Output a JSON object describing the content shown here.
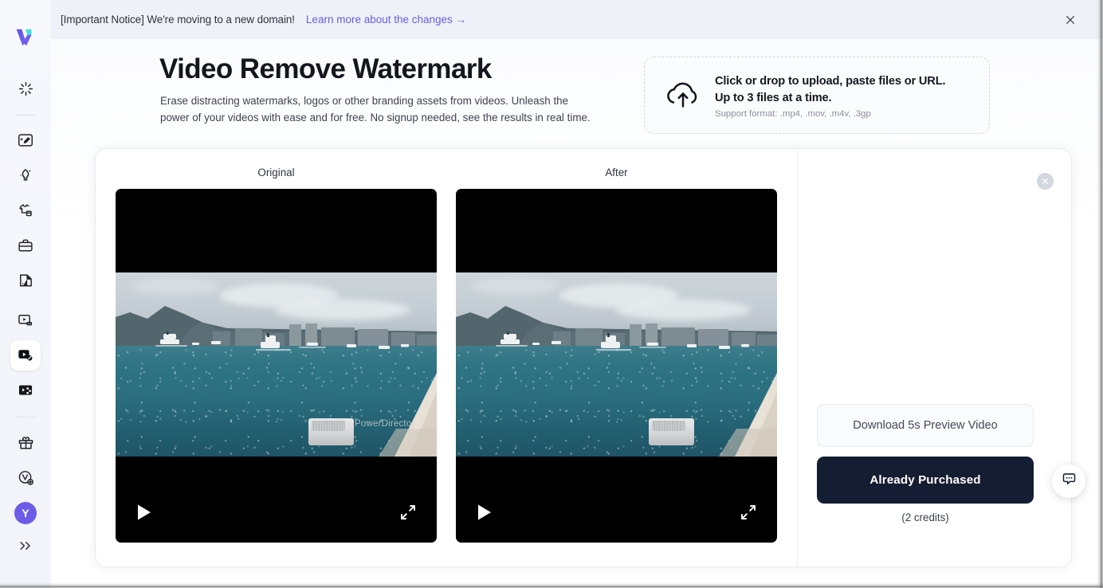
{
  "sidebar": {
    "logo_name": "vidnoz-v-logo",
    "items": [
      {
        "name": "ai-sparkle-loader-icon",
        "label": "AI Generate",
        "icon": "sparkle-loader",
        "active": false
      },
      {
        "name": "image-edit-icon",
        "label": "Image Edit",
        "icon": "image-edit",
        "active": false
      },
      {
        "name": "ai-magic-lamp-icon",
        "label": "AI Magic",
        "icon": "magic-lamp",
        "active": false
      },
      {
        "name": "clothes-swap-icon",
        "label": "Clothes Swap",
        "icon": "clothes",
        "active": false
      },
      {
        "name": "briefcase-icon",
        "label": "Business",
        "icon": "briefcase",
        "active": false
      },
      {
        "name": "page-flip-icon",
        "label": "Pages",
        "icon": "page-flip",
        "active": false
      },
      {
        "name": "video-subtitle-icon",
        "label": "Video Subtitle",
        "icon": "video-cc",
        "active": false
      },
      {
        "name": "video-remove-watermark-icon",
        "label": "Video Remove Watermark",
        "icon": "video-watermark",
        "active": true
      },
      {
        "name": "video-enhance-icon",
        "label": "Video Enhance",
        "icon": "video-enhance",
        "active": false
      },
      {
        "name": "gift-icon",
        "label": "Rewards",
        "icon": "gift",
        "active": false
      },
      {
        "name": "vip-upgrade-icon",
        "label": "Upgrade",
        "icon": "vip-plus",
        "active": false
      }
    ],
    "avatar_initial": "Y",
    "expand_label": "»"
  },
  "notice": {
    "text": "[Important Notice] We're moving to a new domain!",
    "link": "Learn more about the changes →",
    "close_label": "✕"
  },
  "hero": {
    "title": "Video Remove Watermark",
    "subtitle": "Erase distracting watermarks, logos or other branding assets from videos. Unleash the power of your videos with ease and for free. No signup needed, see the results in real time."
  },
  "upload": {
    "line1": "Click or drop to upload, paste files or URL.",
    "line2": "Up to 3 files at a time.",
    "support": "Support format: .mp4, .mov, .m4v, .3gp",
    "icon": "cloud-upload-icon"
  },
  "previews": {
    "original_label": "Original",
    "after_label": "After",
    "watermark_text": "PowerDirector",
    "play_label": "Play",
    "fullscreen_label": "Fullscreen"
  },
  "panel": {
    "close_label": "✕",
    "preview_button": "Download 5s Preview Video",
    "purchase_button": "Already Purchased",
    "credits": "(2 credits)"
  },
  "fab": {
    "name": "chat-bubble-icon",
    "label": "Chat support"
  },
  "colors": {
    "accent_link": "#6a5ce0",
    "avatar": "#6c5ce7",
    "dark_button": "#141d31",
    "notice_bg": "#eef1f7",
    "sidebar_bg": "#f5f6fb"
  }
}
